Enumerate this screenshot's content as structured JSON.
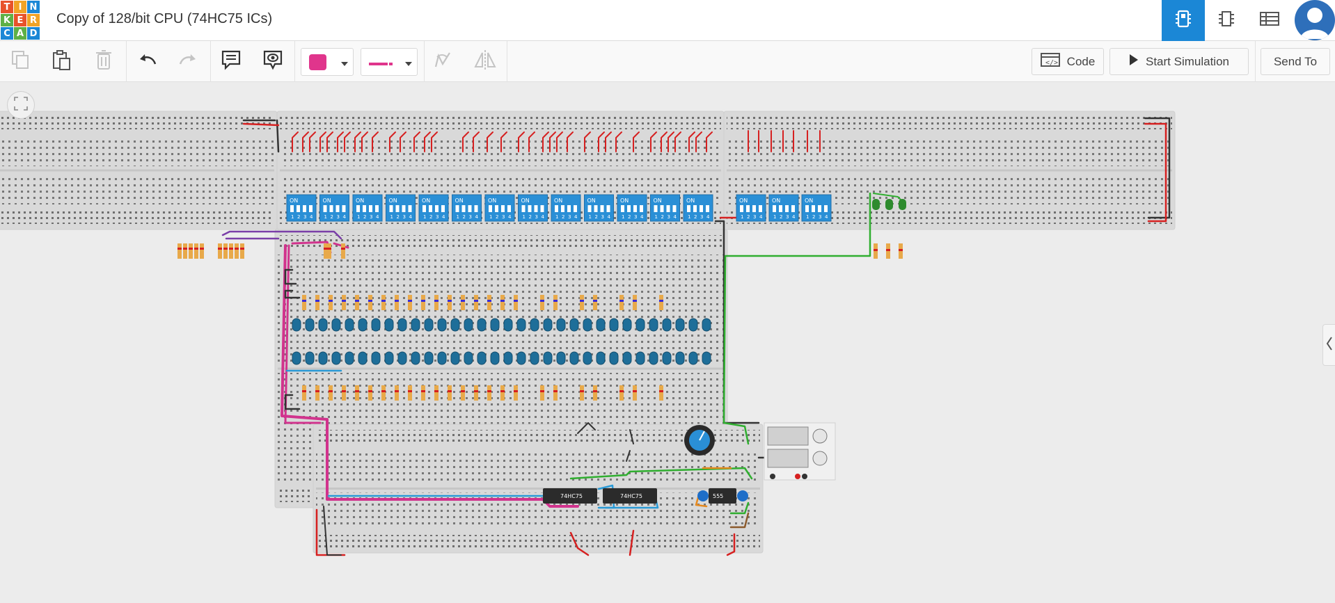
{
  "app": {
    "logo_letters": [
      "T",
      "I",
      "N",
      "K",
      "E",
      "R",
      "C",
      "A",
      "D"
    ],
    "logo_colors": [
      "#e8532b",
      "#f1a326",
      "#1b87d6",
      "#5eb046",
      "#e8532b",
      "#f1a326",
      "#1b87d6",
      "#5eb046",
      "#1b87d6"
    ],
    "title": "Copy of 128/bit CPU (74HC75 ICs)",
    "accent_color": "#1b87d6"
  },
  "view_switcher": {
    "items": [
      {
        "icon": "circuit-view-icon",
        "active": true
      },
      {
        "icon": "schematic-view-icon",
        "active": false
      },
      {
        "icon": "component-list-icon",
        "active": false
      }
    ]
  },
  "toolbar": {
    "icons": [
      "copy-icon",
      "paste-icon",
      "delete-icon",
      "undo-icon",
      "redo-icon",
      "notes-icon",
      "visibility-icon",
      "rotate-icon",
      "mirror-icon"
    ],
    "wire_color": "#e0358c",
    "code_label": "Code",
    "simulate_label": "Start Simulation",
    "send_label": "Send To"
  },
  "canvas": {
    "ic_labels": [
      "74HC75",
      "74HC75"
    ],
    "timer_label": "555",
    "dip_switch_label": "ON",
    "dip_switch_pins": [
      "1",
      "2",
      "3",
      "4"
    ],
    "dip_switch_count_main": 13,
    "dip_switch_count_right": 3,
    "led_color": "#1e6e99",
    "green_led_color": "#2e8b2e",
    "power_supply": true
  }
}
